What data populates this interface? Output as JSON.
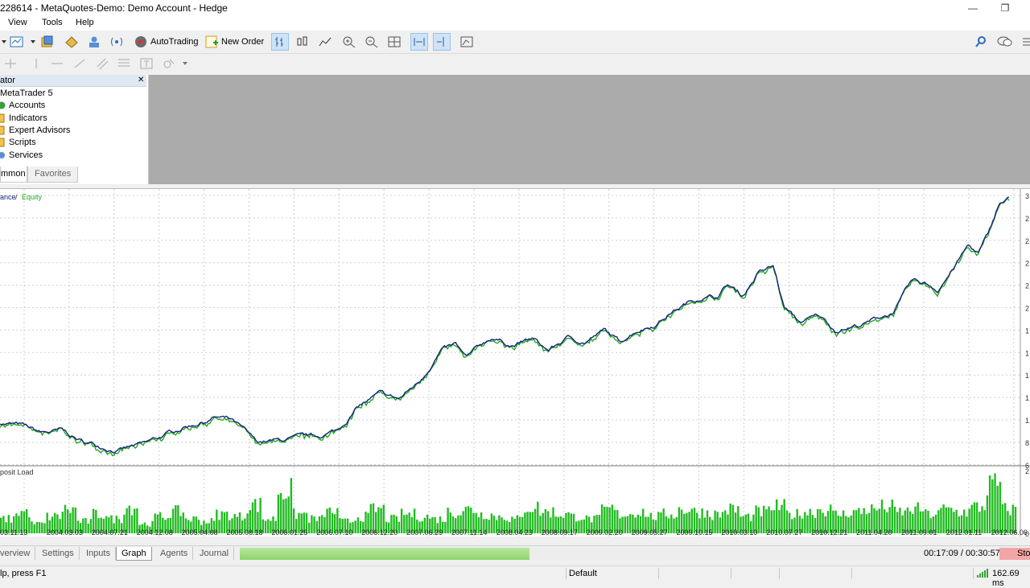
{
  "window": {
    "title": "228614 - MetaQuotes-Demo: Demo Account - Hedge",
    "minimize_glyph": "—",
    "restore_glyph": "❐"
  },
  "menu": [
    "View",
    "Tools",
    "Help"
  ],
  "toolbar": {
    "autotrading_label": "AutoTrading",
    "new_order_label": "New Order"
  },
  "navigator": {
    "title": "ator",
    "items": [
      "MetaTrader 5",
      "Accounts",
      "Indicators",
      "Expert Advisors",
      "Scripts",
      "Services"
    ],
    "tabs": [
      "mmon",
      "Favorites"
    ],
    "close_glyph": "✕"
  },
  "tester": {
    "tabs": [
      "verview",
      "Settings",
      "Inputs",
      "Graph",
      "Agents",
      "Journal"
    ],
    "active_tab": "Graph",
    "timer": "00:17:09 / 00:30:57",
    "stop_label": "Sto",
    "progress": 0.4
  },
  "status": {
    "help": "lp, press F1",
    "profile": "Default",
    "ping": "162.69 ms"
  },
  "colors": {
    "balance": "#1a237e",
    "equity": "#22aa22",
    "load": "#22bb22",
    "grid": "#c8d0d8",
    "progress": "#9ad97a"
  },
  "chart_data": {
    "type": "line",
    "legend": {
      "balance": "ance",
      "separator": " / ",
      "equity": "Equity"
    },
    "load_label": "posit Load",
    "right_tick_labels": [
      "3",
      "2",
      "2",
      "2",
      "2",
      "2",
      "1",
      "1",
      "1",
      "1",
      "1",
      "8",
      "6"
    ],
    "load_tick_labels": [
      "2",
      "0"
    ],
    "x_ticks": [
      "03.11.13",
      "2004.03.03",
      "2004.07.21",
      "2004.12.08",
      "2005.04.08",
      "2005.08.18",
      "2006.01.25",
      "2006.07.10",
      "2006.12.20",
      "2007.06.29",
      "2007.11.14",
      "2008.04.23",
      "2008.09.17",
      "2009.02.20",
      "2009.05.27",
      "2009.10.15",
      "2010.03.10",
      "2010.07.27",
      "2010.12.21",
      "2011.04.20",
      "2011.09.01",
      "2012.01.11",
      "2012.06.06"
    ],
    "balance_shape": [
      [
        0,
        0.157
      ],
      [
        0.02,
        0.146
      ],
      [
        0.04,
        0.117
      ],
      [
        0.06,
        0.125
      ],
      [
        0.08,
        0.084
      ],
      [
        0.1,
        0.067
      ],
      [
        0.115,
        0.053
      ],
      [
        0.14,
        0.073
      ],
      [
        0.16,
        0.106
      ],
      [
        0.18,
        0.142
      ],
      [
        0.2,
        0.163
      ],
      [
        0.21,
        0.178
      ],
      [
        0.225,
        0.166
      ],
      [
        0.235,
        0.136
      ],
      [
        0.25,
        0.081
      ],
      [
        0.27,
        0.087
      ],
      [
        0.29,
        0.096
      ],
      [
        0.31,
        0.102
      ],
      [
        0.33,
        0.128
      ],
      [
        0.35,
        0.218
      ],
      [
        0.37,
        0.262
      ],
      [
        0.39,
        0.244
      ],
      [
        0.41,
        0.314
      ],
      [
        0.43,
        0.427
      ],
      [
        0.445,
        0.448
      ],
      [
        0.455,
        0.395
      ],
      [
        0.47,
        0.448
      ],
      [
        0.48,
        0.477
      ],
      [
        0.5,
        0.448
      ],
      [
        0.52,
        0.471
      ],
      [
        0.535,
        0.427
      ],
      [
        0.555,
        0.477
      ],
      [
        0.57,
        0.459
      ],
      [
        0.59,
        0.503
      ],
      [
        0.605,
        0.459
      ],
      [
        0.62,
        0.503
      ],
      [
        0.64,
        0.529
      ],
      [
        0.655,
        0.573
      ],
      [
        0.67,
        0.605
      ],
      [
        0.685,
        0.631
      ],
      [
        0.7,
        0.631
      ],
      [
        0.71,
        0.677
      ],
      [
        0.725,
        0.634
      ],
      [
        0.74,
        0.721
      ],
      [
        0.755,
        0.744
      ],
      [
        0.765,
        0.593
      ],
      [
        0.78,
        0.535
      ],
      [
        0.8,
        0.558
      ],
      [
        0.815,
        0.506
      ],
      [
        0.83,
        0.517
      ],
      [
        0.845,
        0.53
      ],
      [
        0.86,
        0.555
      ],
      [
        0.87,
        0.567
      ],
      [
        0.88,
        0.622
      ],
      [
        0.89,
        0.686
      ],
      [
        0.905,
        0.677
      ],
      [
        0.915,
        0.657
      ],
      [
        0.93,
        0.735
      ],
      [
        0.945,
        0.823
      ],
      [
        0.955,
        0.794
      ],
      [
        0.965,
        0.866
      ],
      [
        0.975,
        0.98
      ],
      [
        0.985,
        1.0
      ]
    ],
    "load_bars": [
      0.3,
      0.45,
      0.2,
      0.35,
      0.5,
      0.25,
      0.4,
      0.3,
      0.55,
      0.2,
      0.35,
      0.45,
      0.3,
      0.25,
      0.4,
      0.35,
      0.6,
      0.3,
      0.9,
      0.4,
      0.3,
      0.45,
      0.25,
      0.35,
      0.5,
      0.3,
      0.4,
      0.35,
      0.3,
      0.45,
      0.5,
      0.4,
      0.35,
      0.3,
      0.55,
      0.45,
      0.4,
      0.35,
      0.3,
      0.5,
      0.4,
      0.45,
      0.35,
      0.4,
      0.5,
      0.45,
      0.4,
      0.5,
      0.35,
      0.45,
      0.55,
      0.4,
      0.45,
      0.5,
      0.4,
      0.45,
      0.5,
      0.55,
      0.45,
      0.5,
      0.4,
      0.5,
      0.45,
      0.55,
      1.0,
      0.5
    ]
  }
}
